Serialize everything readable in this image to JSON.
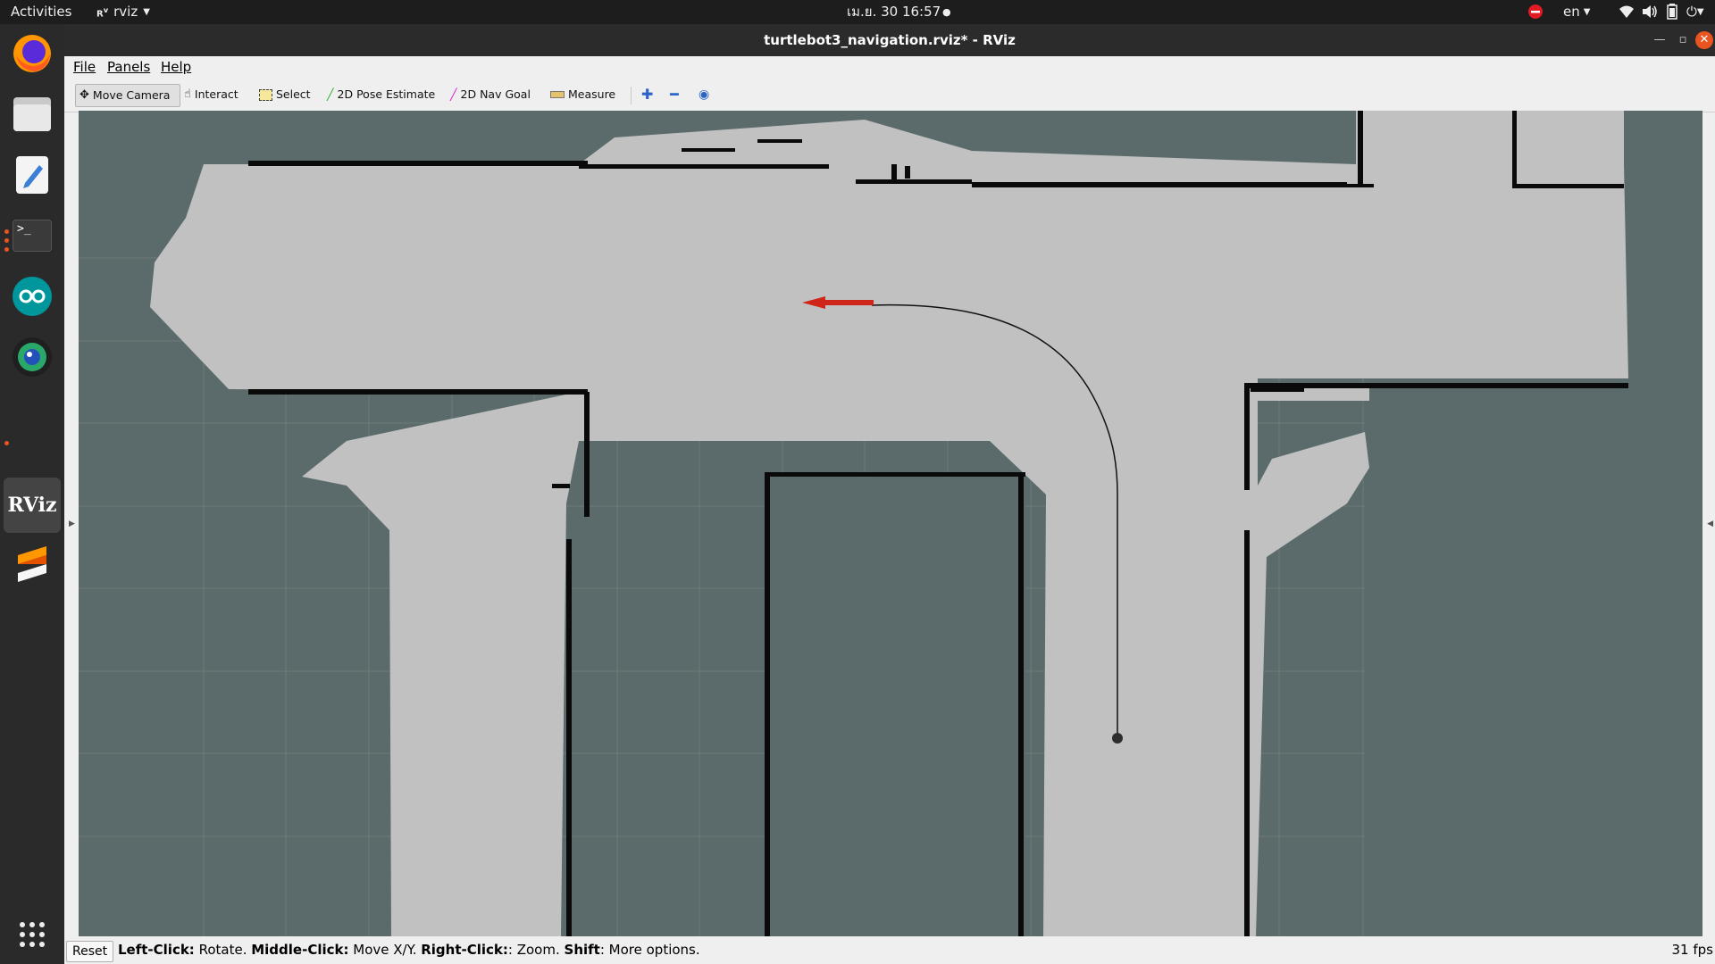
{
  "topbar": {
    "activities": "Activities",
    "app_name": "rviz",
    "clock": "เม.ย. 30  16:57",
    "language": "en"
  },
  "window": {
    "title": "turtlebot3_navigation.rviz* - RViz"
  },
  "menu": {
    "file": "File",
    "panels": "Panels",
    "help": "Help"
  },
  "toolbar": {
    "move_camera": "Move Camera",
    "interact": "Interact",
    "select": "Select",
    "pose_estimate": "2D Pose Estimate",
    "nav_goal": "2D Nav Goal",
    "measure": "Measure"
  },
  "status": {
    "reset": "Reset",
    "left_click": "Left-Click:",
    "left_desc": " Rotate. ",
    "middle_click": "Middle-Click:",
    "middle_desc": " Move X/Y. ",
    "right_click": "Right-Click:",
    "right_desc": ": Zoom. ",
    "shift": "Shift",
    "shift_desc": ": More options.",
    "fps": "31 fps"
  },
  "colors": {
    "unknown_space": "#5b6a6a",
    "free_space": "#c1c1c1",
    "obstacle": "#0a0a0a",
    "goal_arrow": "#d0261a",
    "ubuntu_accent": "#e95420"
  },
  "dock": {
    "apps": [
      "firefox-icon",
      "files-icon",
      "text-editor-icon",
      "terminal-icon",
      "arduino-icon",
      "camera-app-icon",
      "rviz-icon",
      "sublime-icon"
    ],
    "terminal_label": ">_",
    "rviz_label": "RViz"
  }
}
